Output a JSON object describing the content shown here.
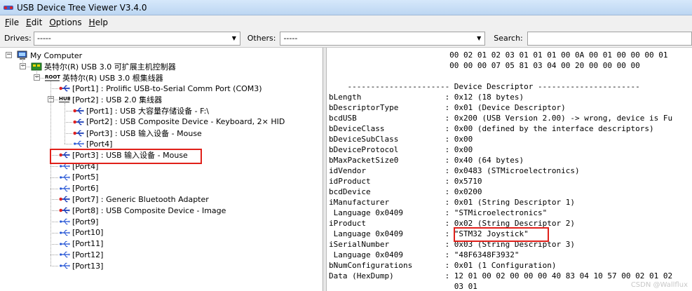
{
  "window": {
    "title": "USB Device Tree Viewer V3.4.0"
  },
  "menu": [
    {
      "key": "F",
      "rest": "ile"
    },
    {
      "key": "E",
      "rest": "dit"
    },
    {
      "key": "O",
      "rest": "ptions"
    },
    {
      "key": "H",
      "rest": "elp"
    }
  ],
  "toolbar": {
    "drives_label": "Drives:",
    "drives_value": "-----",
    "others_label": "Others:",
    "others_value": "-----",
    "search_label": "Search:",
    "search_value": ""
  },
  "tree": [
    {
      "text": "My Computer",
      "icon": "computer-icon",
      "indent": 0
    },
    {
      "text": "英特尔(R) USB 3.0 可扩展主机控制器",
      "icon": "host-controller-icon",
      "indent": 1
    },
    {
      "text": "英特尔(R) USB 3.0 根集线器",
      "icon": "root-hub-icon",
      "indent": 2
    },
    {
      "text": "[Port1] : Prolific USB-to-Serial Comm Port (COM3)",
      "icon": "usb-device-icon",
      "indent": 3
    },
    {
      "text": "[Port2] : USB 2.0 集线器",
      "icon": "hub-icon",
      "indent": 3
    },
    {
      "text": "[Port1] : USB 大容量存储设备 - F:\\",
      "icon": "usb-device-icon",
      "indent": 4
    },
    {
      "text": "[Port2] : USB Composite Device - Keyboard, 2× HID",
      "icon": "usb-device-icon",
      "indent": 4
    },
    {
      "text": "[Port3] : USB 输入设备 - Mouse",
      "icon": "usb-device-icon",
      "indent": 4
    },
    {
      "text": "[Port4]",
      "icon": "usb-port-icon",
      "indent": 4
    },
    {
      "text": "[Port3] : USB 输入设备 - Mouse",
      "icon": "usb-device-icon",
      "indent": 3
    },
    {
      "text": "[Port4]",
      "icon": "usb-port-icon",
      "indent": 3
    },
    {
      "text": "[Port5]",
      "icon": "usb-port-icon",
      "indent": 3
    },
    {
      "text": "[Port6]",
      "icon": "usb-port-icon",
      "indent": 3
    },
    {
      "text": "[Port7] : Generic Bluetooth Adapter",
      "icon": "usb-device-icon",
      "indent": 3
    },
    {
      "text": "[Port8] : USB Composite Device - Image",
      "icon": "usb-device-icon",
      "indent": 3
    },
    {
      "text": "[Port9]",
      "icon": "usb-port-icon",
      "indent": 3
    },
    {
      "text": "[Port10]",
      "icon": "usb-port-icon",
      "indent": 3
    },
    {
      "text": "[Port11]",
      "icon": "usb-port-icon",
      "indent": 3
    },
    {
      "text": "[Port12]",
      "icon": "usb-port-icon",
      "indent": 3
    },
    {
      "text": "[Port13]",
      "icon": "usb-port-icon",
      "indent": 3
    }
  ],
  "details": [
    "                          00 02 01 02 03 01 01 01 00 0A 00 01 00 00 00 01",
    "                          00 00 00 07 05 81 03 04 00 20 00 00 00 00",
    "",
    "    ---------------------- Device Descriptor ----------------------",
    "bLength                  : 0x12 (18 bytes)",
    "bDescriptorType          : 0x01 (Device Descriptor)",
    "bcdUSB                   : 0x200 (USB Version 2.00) -> wrong, device is Fu",
    "bDeviceClass             : 0x00 (defined by the interface descriptors)",
    "bDeviceSubClass          : 0x00",
    "bDeviceProtocol          : 0x00",
    "bMaxPacketSize0          : 0x40 (64 bytes)",
    "idVendor                 : 0x0483 (STMicroelectronics)",
    "idProduct                : 0x5710",
    "bcdDevice                : 0x0200",
    "iManufacturer            : 0x01 (String Descriptor 1)",
    " Language 0x0409         : \"STMicroelectronics\"",
    "iProduct                 : 0x02 (String Descriptor 2)",
    " Language 0x0409         : \"STM32 Joystick\"",
    "iSerialNumber            : 0x03 (String Descriptor 3)",
    " Language 0x0409         : \"48F6348F3932\"",
    "bNumConfigurations       : 0x01 (1 Configuration)",
    "Data (HexDump)           : 12 01 00 02 00 00 00 40 83 04 10 57 00 02 01 02",
    "                           03 01"
  ],
  "watermark": "CSDN @Wallflux",
  "colors": {
    "highlight": "#e0201a",
    "titlebar": "#cfe3f9"
  }
}
